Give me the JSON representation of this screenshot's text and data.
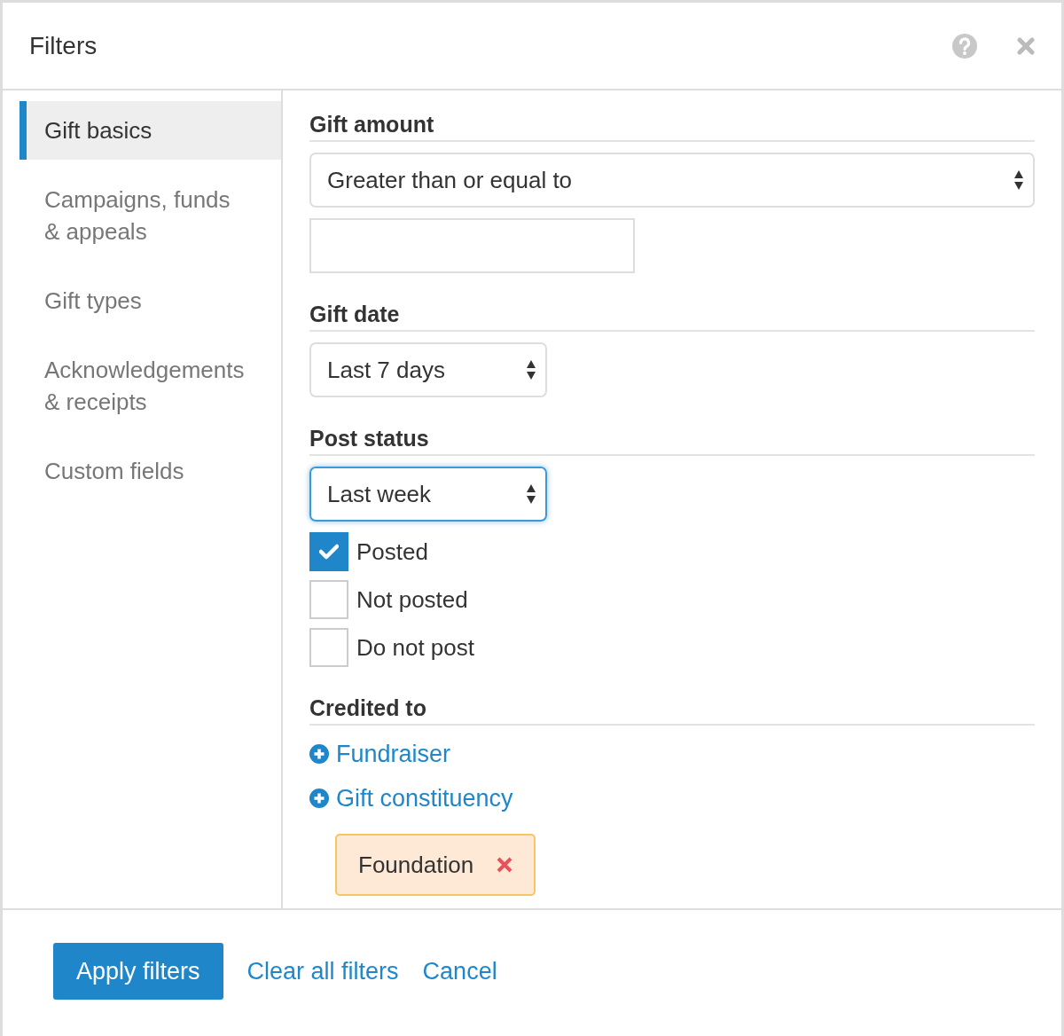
{
  "dialog": {
    "title": "Filters"
  },
  "sidebar": {
    "items": [
      {
        "label": "Gift basics",
        "selected": true
      },
      {
        "label": "Campaigns, funds & appeals",
        "selected": false
      },
      {
        "label": "Gift types",
        "selected": false
      },
      {
        "label": "Acknowledgements & receipts",
        "selected": false
      },
      {
        "label": "Custom fields",
        "selected": false
      }
    ]
  },
  "sections": [
    {
      "heading": "Gift amount",
      "controls": [
        {
          "kind": "select",
          "value": "Greater than or equal to",
          "focused": false
        },
        {
          "kind": "input"
        }
      ]
    },
    {
      "heading": "Gift date",
      "controls": [
        {
          "kind": "select",
          "value": "Last 7 days",
          "focused": false
        }
      ]
    },
    {
      "heading": "Post status",
      "controls": [
        {
          "kind": "select",
          "value": "Last week",
          "focused": true
        },
        {
          "kind": "checkbox",
          "label": "Posted",
          "checked": true
        },
        {
          "kind": "checkbox",
          "label": "Not posted",
          "checked": false
        },
        {
          "kind": "checkbox",
          "label": "Do not post",
          "checked": false
        }
      ]
    },
    {
      "heading": "Credited to",
      "controls": [
        {
          "kind": "add-link",
          "label": "Fundraiser"
        },
        {
          "kind": "add-link",
          "label": "Gift constituency"
        },
        {
          "kind": "tag",
          "label": "Foundation"
        }
      ]
    }
  ],
  "footer": {
    "buttons": [
      {
        "kind": "primary",
        "label": "Apply filters"
      },
      {
        "kind": "link",
        "label": "Clear all filters"
      },
      {
        "kind": "link",
        "label": "Cancel"
      }
    ]
  }
}
